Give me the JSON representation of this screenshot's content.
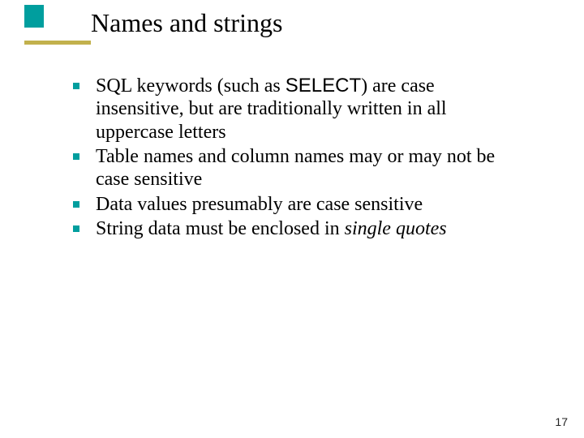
{
  "title": "Names and strings",
  "bullets": {
    "b0": {
      "pre": "SQL keywords (such as ",
      "code": "SELECT",
      "post": ") are case insensitive, but are traditionally written in all uppercase letters"
    },
    "b1": "Table names and column names may or may not be case sensitive",
    "b2": "Data values presumably are case sensitive",
    "b3": {
      "pre": "String data must be enclosed in ",
      "em": "single quotes"
    }
  },
  "page_number": "17"
}
